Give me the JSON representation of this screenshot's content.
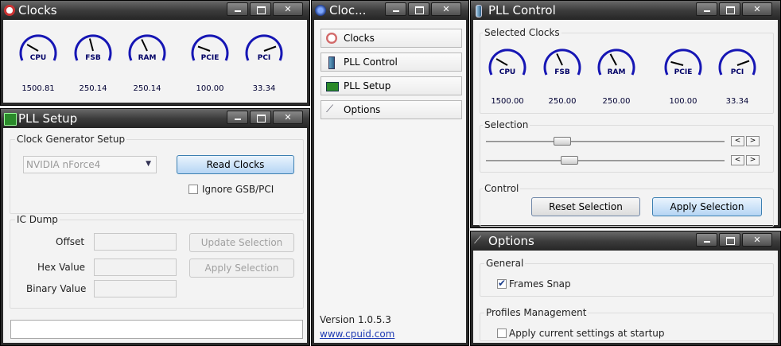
{
  "clocks_window": {
    "title": "Clocks",
    "gauges": [
      {
        "label": "CPU",
        "value": "1500.81"
      },
      {
        "label": "FSB",
        "value": "250.14"
      },
      {
        "label": "RAM",
        "value": "250.14"
      },
      {
        "label": "PCIE",
        "value": "100.00"
      },
      {
        "label": "PCI",
        "value": "33.34"
      }
    ]
  },
  "pll_setup_window": {
    "title": "PLL Setup",
    "clock_generator_group": "Clock Generator Setup",
    "generator_select": "NVIDIA nForce4",
    "read_clocks_label": "Read Clocks",
    "ignore_label": "Ignore GSB/PCI",
    "ic_dump_group": "IC Dump",
    "offset_label": "Offset",
    "hex_label": "Hex Value",
    "binary_label": "Binary Value",
    "update_selection_label": "Update Selection",
    "apply_selection_label": "Apply Selection"
  },
  "main_window": {
    "title": "Cloc...",
    "nav": [
      {
        "label": "Clocks",
        "icon": "clock-icon"
      },
      {
        "label": "PLL Control",
        "icon": "pll-control-icon"
      },
      {
        "label": "PLL Setup",
        "icon": "chip-icon"
      },
      {
        "label": "Options",
        "icon": "wrench-icon"
      }
    ],
    "version": "Version 1.0.5.3",
    "link": "www.cpuid.com"
  },
  "pll_control_window": {
    "title": "PLL Control",
    "selected_clocks_group": "Selected Clocks",
    "gauges": [
      {
        "label": "CPU",
        "value": "1500.00"
      },
      {
        "label": "FSB",
        "value": "250.00"
      },
      {
        "label": "RAM",
        "value": "250.00"
      },
      {
        "label": "PCIE",
        "value": "100.00"
      },
      {
        "label": "PCI",
        "value": "33.34"
      }
    ],
    "selection_group": "Selection",
    "spin_left": "<",
    "spin_right": ">",
    "control_group": "Control",
    "reset_label": "Reset Selection",
    "apply_label": "Apply Selection"
  },
  "options_window": {
    "title": "Options",
    "general_group": "General",
    "frames_snap_label": "Frames Snap",
    "frames_snap_checked": true,
    "profiles_group": "Profiles Management",
    "startup_label": "Apply current settings at startup",
    "startup_checked": false
  }
}
